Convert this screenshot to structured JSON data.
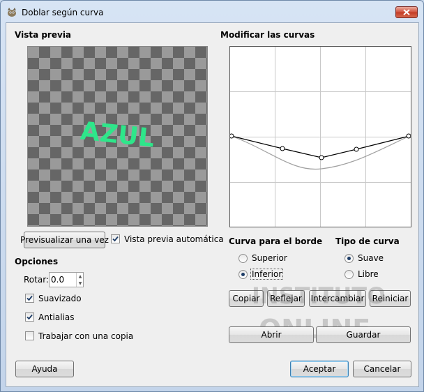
{
  "window": {
    "title": "Doblar según curva"
  },
  "preview": {
    "heading": "Vista previa",
    "preview_text": "AZUL",
    "preview_once_button": "Previsualizar una vez",
    "auto_preview_label": "Vista previa automática",
    "auto_preview_checked": true
  },
  "options": {
    "heading": "Opciones",
    "rotate_label": "Rotar:",
    "rotate_value": "0.0",
    "smoothing_label": "Suavizado",
    "smoothing_checked": true,
    "antialias_label": "Antialias",
    "antialias_checked": true,
    "work_on_copy_label": "Trabajar con una copia",
    "work_on_copy_checked": false
  },
  "curves": {
    "heading": "Modificar las curvas",
    "edge_heading": "Curva para el borde",
    "edge_upper": "Superior",
    "edge_lower": "Inferior",
    "edge_selected": "Inferior",
    "type_heading": "Tipo de curva",
    "type_smooth": "Suave",
    "type_free": "Libre",
    "type_selected": "Suave",
    "copy_button": "Copiar",
    "mirror_button": "Reflejar",
    "swap_button": "Intercambiar",
    "reset_button": "Reiniciar",
    "open_button": "Abrir",
    "save_button": "Guardar"
  },
  "footer": {
    "help_button": "Ayuda",
    "ok_button": "Aceptar",
    "cancel_button": "Cancelar"
  },
  "colors": {
    "preview_text": "#2ee68a",
    "curve_active": "#000000",
    "curve_inactive": "#a0a0a0",
    "close_button": "#c8412a"
  }
}
